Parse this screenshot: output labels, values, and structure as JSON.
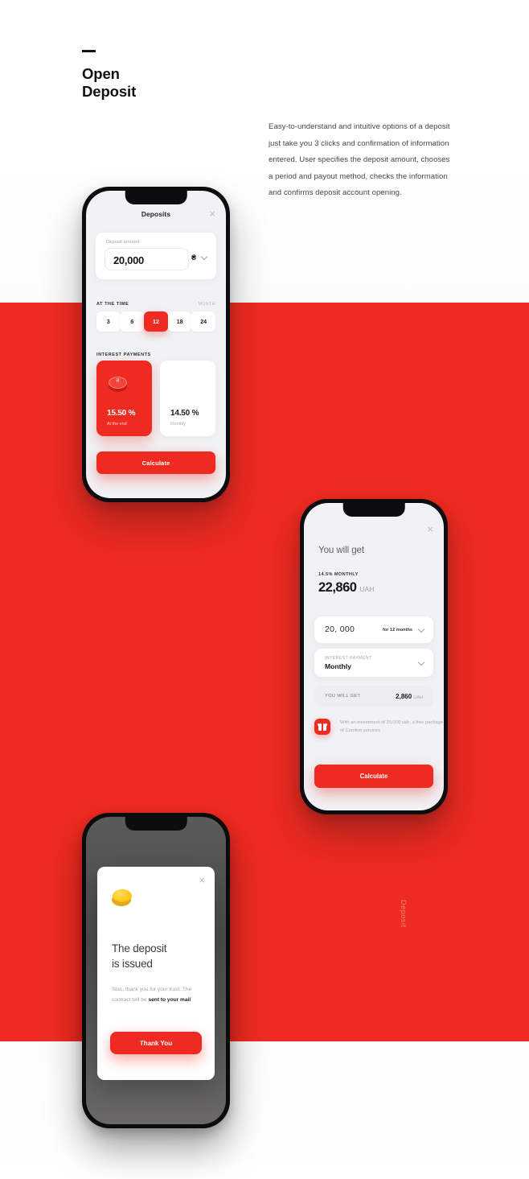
{
  "header": {
    "dash": "—",
    "line1": "Open",
    "line2": "Deposit"
  },
  "intro": {
    "text": "Easy-to-understand and intuitive options of a deposit just take you 3 clicks and confirmation of information entered. User specifies the deposit amount, chooses a period and payout method, checks the information and confirms deposit account opening."
  },
  "vertical_label": "Deposit",
  "colors": {
    "brand_red": "#ef2b21",
    "screen_bg": "#f1f2f5",
    "text_dark": "#14161b"
  },
  "phone1": {
    "title": "Deposits",
    "close_icon": "×",
    "deposit_amount_label": "Deposit amount",
    "deposit_amount_value": "20,000",
    "currency": "₴",
    "section_time": "AT THE TIME",
    "section_time_unit": "MONTH",
    "terms": [
      "3",
      "6",
      "12",
      "18",
      "24"
    ],
    "active_term": "12",
    "section_interest": "INTEREST PAYMENTS",
    "interest_cards": [
      {
        "percent": "15.50 %",
        "sub": "At the end",
        "selected": true,
        "icon": "coin-icon"
      },
      {
        "percent": "14.50 %",
        "sub": "Monthly",
        "selected": false
      }
    ],
    "calculate_label": "Calculate"
  },
  "phone2": {
    "close_icon": "×",
    "title": "You will get",
    "kicker": "14.5% MONTHLY",
    "total_value": "22,860",
    "total_unit": "UAH",
    "amount_value": "20, 000",
    "period_value": "for 12 months",
    "interest_label": "INTEREST PAYMENT",
    "interest_value": "Monthly",
    "will_get_label": "YOU WILL GET",
    "will_get_value": "2,860",
    "will_get_unit": "UAH",
    "promo_text": "With an investment of 20,000 uah, a free package of Comfort services",
    "promo_icon": "gift-icon",
    "calculate_label": "Calculate"
  },
  "phone3": {
    "close_icon": "×",
    "coin_icon": "gold-coin-icon",
    "title_line1": "The deposit",
    "title_line2": "is issued",
    "body_normal": "Stas, thank you for your trust. The contract will be ",
    "body_bold": "sent to your mail",
    "button_label": "Thank You"
  }
}
